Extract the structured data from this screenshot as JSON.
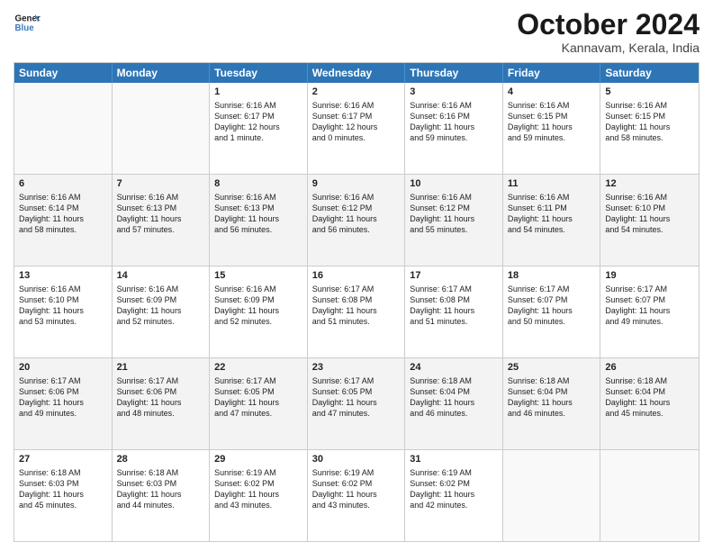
{
  "header": {
    "logo_line1": "General",
    "logo_line2": "Blue",
    "month": "October 2024",
    "location": "Kannavam, Kerala, India"
  },
  "weekdays": [
    "Sunday",
    "Monday",
    "Tuesday",
    "Wednesday",
    "Thursday",
    "Friday",
    "Saturday"
  ],
  "rows": [
    [
      {
        "day": "",
        "info": ""
      },
      {
        "day": "",
        "info": ""
      },
      {
        "day": "1",
        "info": "Sunrise: 6:16 AM\nSunset: 6:17 PM\nDaylight: 12 hours\nand 1 minute."
      },
      {
        "day": "2",
        "info": "Sunrise: 6:16 AM\nSunset: 6:17 PM\nDaylight: 12 hours\nand 0 minutes."
      },
      {
        "day": "3",
        "info": "Sunrise: 6:16 AM\nSunset: 6:16 PM\nDaylight: 11 hours\nand 59 minutes."
      },
      {
        "day": "4",
        "info": "Sunrise: 6:16 AM\nSunset: 6:15 PM\nDaylight: 11 hours\nand 59 minutes."
      },
      {
        "day": "5",
        "info": "Sunrise: 6:16 AM\nSunset: 6:15 PM\nDaylight: 11 hours\nand 58 minutes."
      }
    ],
    [
      {
        "day": "6",
        "info": "Sunrise: 6:16 AM\nSunset: 6:14 PM\nDaylight: 11 hours\nand 58 minutes."
      },
      {
        "day": "7",
        "info": "Sunrise: 6:16 AM\nSunset: 6:13 PM\nDaylight: 11 hours\nand 57 minutes."
      },
      {
        "day": "8",
        "info": "Sunrise: 6:16 AM\nSunset: 6:13 PM\nDaylight: 11 hours\nand 56 minutes."
      },
      {
        "day": "9",
        "info": "Sunrise: 6:16 AM\nSunset: 6:12 PM\nDaylight: 11 hours\nand 56 minutes."
      },
      {
        "day": "10",
        "info": "Sunrise: 6:16 AM\nSunset: 6:12 PM\nDaylight: 11 hours\nand 55 minutes."
      },
      {
        "day": "11",
        "info": "Sunrise: 6:16 AM\nSunset: 6:11 PM\nDaylight: 11 hours\nand 54 minutes."
      },
      {
        "day": "12",
        "info": "Sunrise: 6:16 AM\nSunset: 6:10 PM\nDaylight: 11 hours\nand 54 minutes."
      }
    ],
    [
      {
        "day": "13",
        "info": "Sunrise: 6:16 AM\nSunset: 6:10 PM\nDaylight: 11 hours\nand 53 minutes."
      },
      {
        "day": "14",
        "info": "Sunrise: 6:16 AM\nSunset: 6:09 PM\nDaylight: 11 hours\nand 52 minutes."
      },
      {
        "day": "15",
        "info": "Sunrise: 6:16 AM\nSunset: 6:09 PM\nDaylight: 11 hours\nand 52 minutes."
      },
      {
        "day": "16",
        "info": "Sunrise: 6:17 AM\nSunset: 6:08 PM\nDaylight: 11 hours\nand 51 minutes."
      },
      {
        "day": "17",
        "info": "Sunrise: 6:17 AM\nSunset: 6:08 PM\nDaylight: 11 hours\nand 51 minutes."
      },
      {
        "day": "18",
        "info": "Sunrise: 6:17 AM\nSunset: 6:07 PM\nDaylight: 11 hours\nand 50 minutes."
      },
      {
        "day": "19",
        "info": "Sunrise: 6:17 AM\nSunset: 6:07 PM\nDaylight: 11 hours\nand 49 minutes."
      }
    ],
    [
      {
        "day": "20",
        "info": "Sunrise: 6:17 AM\nSunset: 6:06 PM\nDaylight: 11 hours\nand 49 minutes."
      },
      {
        "day": "21",
        "info": "Sunrise: 6:17 AM\nSunset: 6:06 PM\nDaylight: 11 hours\nand 48 minutes."
      },
      {
        "day": "22",
        "info": "Sunrise: 6:17 AM\nSunset: 6:05 PM\nDaylight: 11 hours\nand 47 minutes."
      },
      {
        "day": "23",
        "info": "Sunrise: 6:17 AM\nSunset: 6:05 PM\nDaylight: 11 hours\nand 47 minutes."
      },
      {
        "day": "24",
        "info": "Sunrise: 6:18 AM\nSunset: 6:04 PM\nDaylight: 11 hours\nand 46 minutes."
      },
      {
        "day": "25",
        "info": "Sunrise: 6:18 AM\nSunset: 6:04 PM\nDaylight: 11 hours\nand 46 minutes."
      },
      {
        "day": "26",
        "info": "Sunrise: 6:18 AM\nSunset: 6:04 PM\nDaylight: 11 hours\nand 45 minutes."
      }
    ],
    [
      {
        "day": "27",
        "info": "Sunrise: 6:18 AM\nSunset: 6:03 PM\nDaylight: 11 hours\nand 45 minutes."
      },
      {
        "day": "28",
        "info": "Sunrise: 6:18 AM\nSunset: 6:03 PM\nDaylight: 11 hours\nand 44 minutes."
      },
      {
        "day": "29",
        "info": "Sunrise: 6:19 AM\nSunset: 6:02 PM\nDaylight: 11 hours\nand 43 minutes."
      },
      {
        "day": "30",
        "info": "Sunrise: 6:19 AM\nSunset: 6:02 PM\nDaylight: 11 hours\nand 43 minutes."
      },
      {
        "day": "31",
        "info": "Sunrise: 6:19 AM\nSunset: 6:02 PM\nDaylight: 11 hours\nand 42 minutes."
      },
      {
        "day": "",
        "info": ""
      },
      {
        "day": "",
        "info": ""
      }
    ]
  ]
}
